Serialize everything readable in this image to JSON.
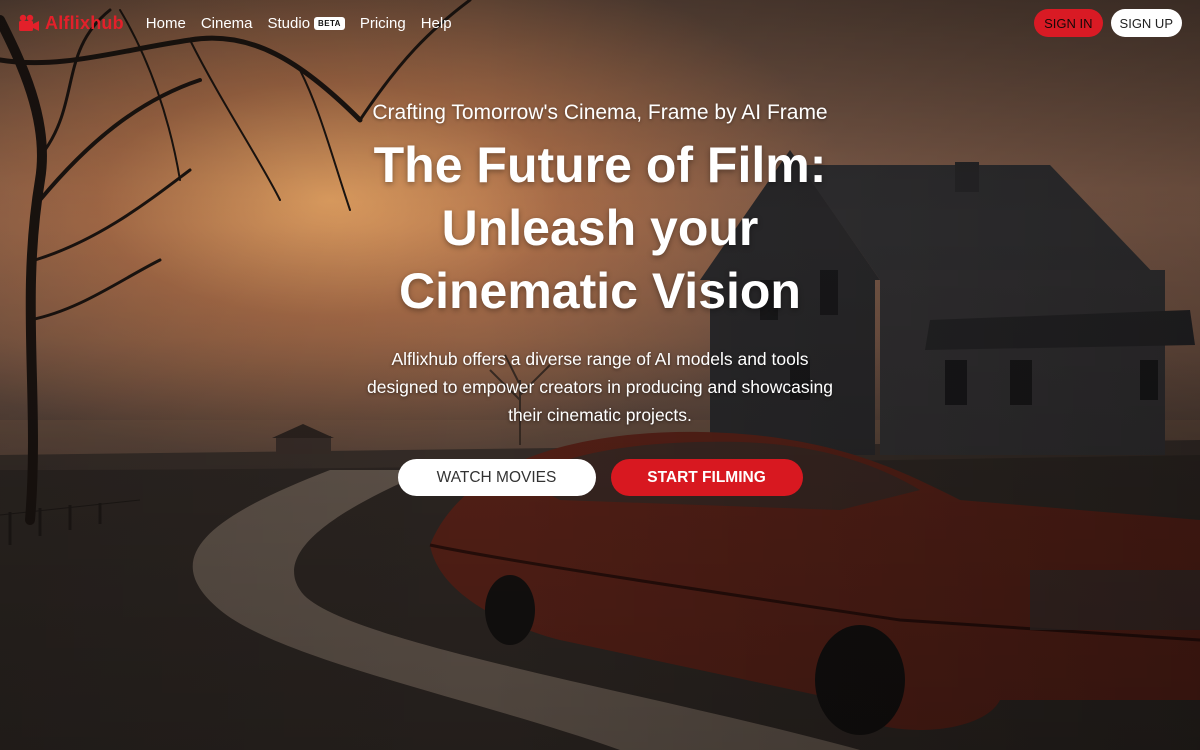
{
  "brand": {
    "name": "Alflixhub",
    "color": "#e3202a",
    "icon": "film-camera-icon"
  },
  "nav": {
    "links": [
      {
        "label": "Home"
      },
      {
        "label": "Cinema"
      },
      {
        "label": "Studio",
        "badge": "BETA"
      },
      {
        "label": "Pricing"
      },
      {
        "label": "Help"
      }
    ],
    "sign_in": "SIGN IN",
    "sign_up": "SIGN UP"
  },
  "hero": {
    "tagline": "Crafting Tomorrow's Cinema, Frame by AI Frame",
    "title": "The Future of Film: Unleash your Cinematic Vision",
    "description": "Alflixhub offers a diverse range of AI models and tools designed to empower creators in producing and showcasing their cinematic projects.",
    "cta_watch": "WATCH MOVIES",
    "cta_film": "START FILMING"
  },
  "colors": {
    "accent": "#d81820",
    "button_light": "#ffffff"
  }
}
